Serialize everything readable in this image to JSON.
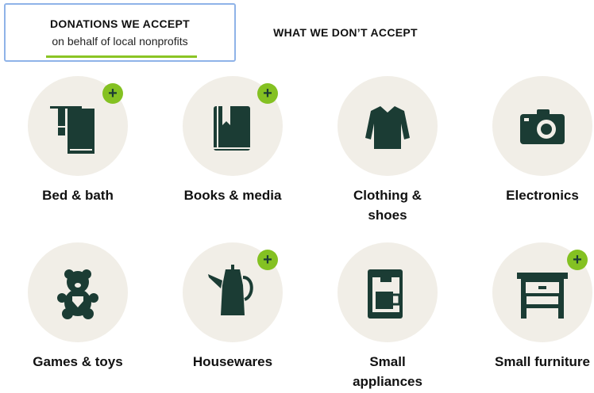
{
  "tabs": {
    "accept_title": "DONATIONS WE ACCEPT",
    "accept_subtitle": "on behalf of local nonprofits",
    "dont_title": "WHAT WE DON’T ACCEPT"
  },
  "colors": {
    "icon": "#1b3c34",
    "circle": "#f1eee7",
    "plus_badge": "#84c122",
    "active_tab_border": "#8fb3e8"
  },
  "plus_symbol": "+",
  "categories": [
    {
      "label_lines": [
        "Bed & bath"
      ],
      "icon": "towel-rack-icon",
      "has_plus": true
    },
    {
      "label_lines": [
        "Books & media"
      ],
      "icon": "book-icon",
      "has_plus": true
    },
    {
      "label_lines": [
        "Clothing &",
        "shoes"
      ],
      "icon": "sweater-icon",
      "has_plus": false
    },
    {
      "label_lines": [
        "Electronics"
      ],
      "icon": "camera-icon",
      "has_plus": false
    },
    {
      "label_lines": [
        "Games & toys"
      ],
      "icon": "teddy-bear-icon",
      "has_plus": false
    },
    {
      "label_lines": [
        "Housewares"
      ],
      "icon": "coffee-pot-icon",
      "has_plus": true
    },
    {
      "label_lines": [
        "Small",
        "appliances"
      ],
      "icon": "coffee-maker-icon",
      "has_plus": false
    },
    {
      "label_lines": [
        "Small furniture"
      ],
      "icon": "nightstand-icon",
      "has_plus": true
    }
  ]
}
